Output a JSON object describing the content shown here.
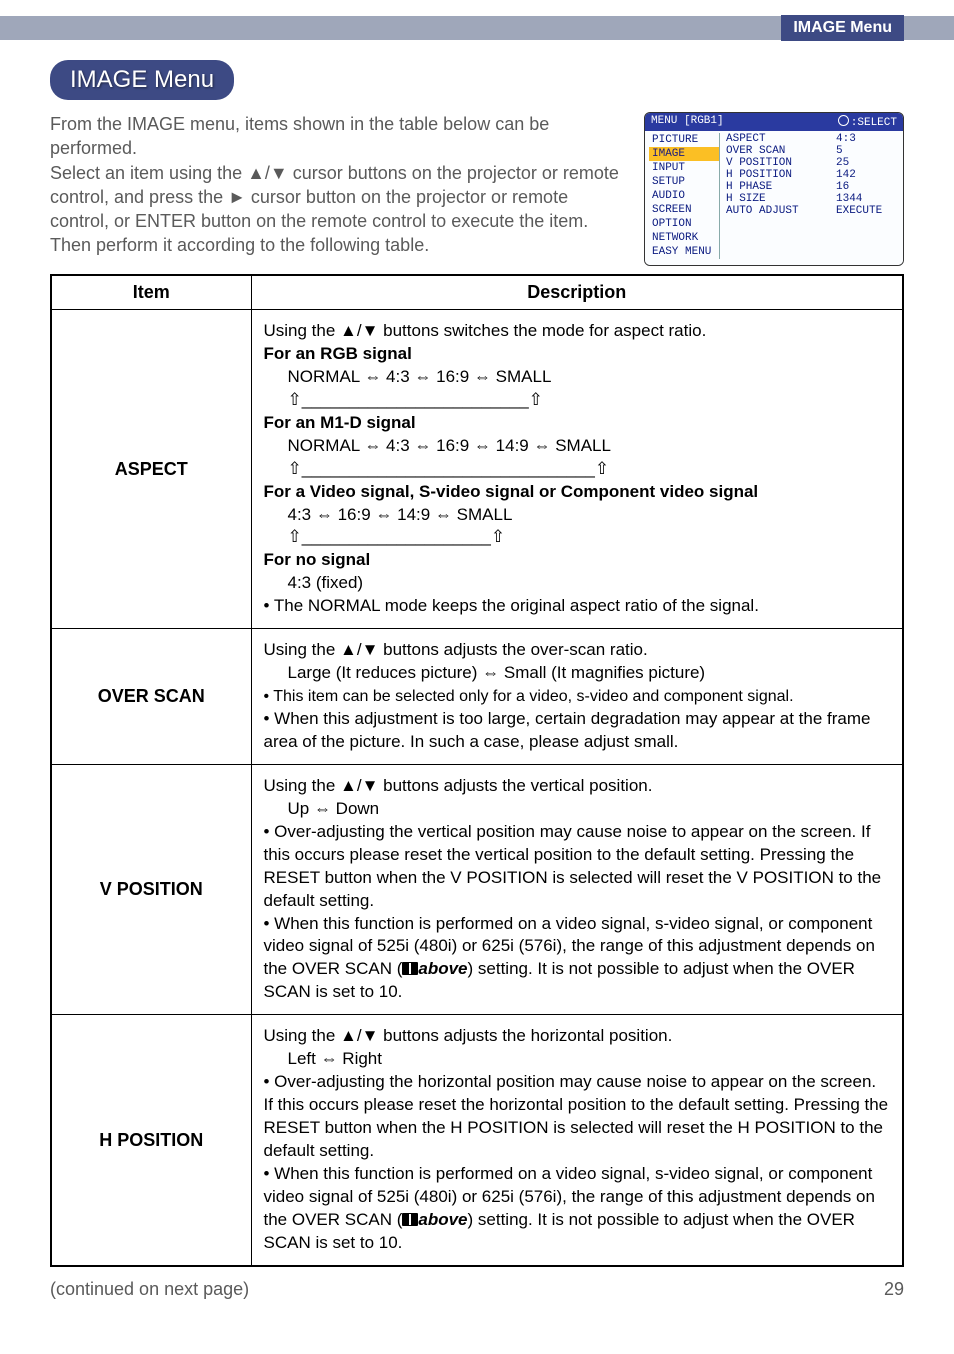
{
  "header": {
    "section_label": "IMAGE Menu"
  },
  "title": "IMAGE Menu",
  "intro": "From the IMAGE menu, items shown in the table below can be performed.\nSelect an item using the ▲/▼ cursor buttons on the projector or remote control, and press the ► cursor button on the projector or remote control, or ENTER button on the remote control to execute the item. Then perform it according to the following table.",
  "osd": {
    "top_left": "MENU [RGB1]",
    "top_right_icon": "⟳",
    "top_right": ":SELECT",
    "left_items": [
      "PICTURE",
      "IMAGE",
      "INPUT",
      "SETUP",
      "AUDIO",
      "SCREEN",
      "OPTION",
      "NETWORK",
      "EASY MENU"
    ],
    "selected_index": 1,
    "right_rows": [
      {
        "label": "ASPECT",
        "value": "4:3"
      },
      {
        "label": "OVER SCAN",
        "value": "5"
      },
      {
        "label": "V POSITION",
        "value": "25"
      },
      {
        "label": "H POSITION",
        "value": "142"
      },
      {
        "label": "H PHASE",
        "value": "16"
      },
      {
        "label": "H SIZE",
        "value": "1344"
      },
      {
        "label": "AUTO ADJUST",
        "value": "EXECUTE"
      }
    ]
  },
  "table": {
    "headers": {
      "item": "Item",
      "description": "Description"
    },
    "rows": [
      {
        "item": "ASPECT",
        "desc": {
          "lead": "Using the ▲/▼ buttons switches the mode for aspect ratio.",
          "rgb_head": "For an RGB signal",
          "rgb_line": "NORMAL ⇔ 4:3 ⇔ 16:9 ⇔ SMALL",
          "m1d_head": "For an M1-D signal",
          "m1d_line": "NORMAL ⇔ 4:3 ⇔ 16:9 ⇔ 14:9 ⇔ SMALL",
          "video_head": "For a Video signal, S-video signal or Component video signal",
          "video_line": "4:3 ⇔ 16:9 ⇔ 14:9 ⇔ SMALL",
          "nosig_head": "For no signal",
          "nosig_line": "4:3 (fixed)",
          "note": "• The NORMAL mode keeps the original aspect ratio of the signal."
        }
      },
      {
        "item": "OVER SCAN",
        "desc": {
          "lead": "Using the ▲/▼ buttons adjusts the over-scan ratio.",
          "line2": "Large (It reduces picture) ⇔ Small (It magnifies picture)",
          "b1": "• This item can be selected only for a video, s-video and component signal.",
          "b2": "• When this adjustment is too large, certain degradation may appear at the frame area of the picture. In such a case, please adjust small."
        }
      },
      {
        "item": "V POSITION",
        "desc": {
          "lead": "Using the ▲/▼ buttons adjusts the vertical position.",
          "line2": "Up ⇔ Down",
          "b1": "• Over-adjusting the vertical position may cause noise to appear on the screen. If this occurs please reset the vertical position to the default setting. Pressing the RESET button when the V POSITION is selected will reset the V POSITION to the default setting.",
          "b2a": "• When this function is performed on a video signal, s-video signal, or component video signal of 525i (480i) or 625i (576i), the range of this adjustment depends on the OVER SCAN (",
          "b2ref": "above",
          "b2b": ") setting. It is not possible to adjust when the OVER SCAN is set to 10."
        }
      },
      {
        "item": "H POSITION",
        "desc": {
          "lead": "Using the ▲/▼ buttons adjusts the horizontal position.",
          "line2": "Left ⇔ Right",
          "b1": "• Over-adjusting the horizontal position may cause noise to appear on the screen. If this occurs please reset the horizontal position to the default setting. Pressing the RESET button when the H POSITION is selected will reset the H POSITION to the default setting.",
          "b2a": "• When this function is performed on a video signal, s-video signal, or component video signal of 525i (480i) or 625i (576i), the range of this adjustment depends on the OVER SCAN (",
          "b2ref": "above",
          "b2b": ") setting. It is not possible to adjust when the OVER SCAN is set to 10."
        }
      }
    ]
  },
  "footer": {
    "continued": "(continued on next page)",
    "page": "29"
  }
}
